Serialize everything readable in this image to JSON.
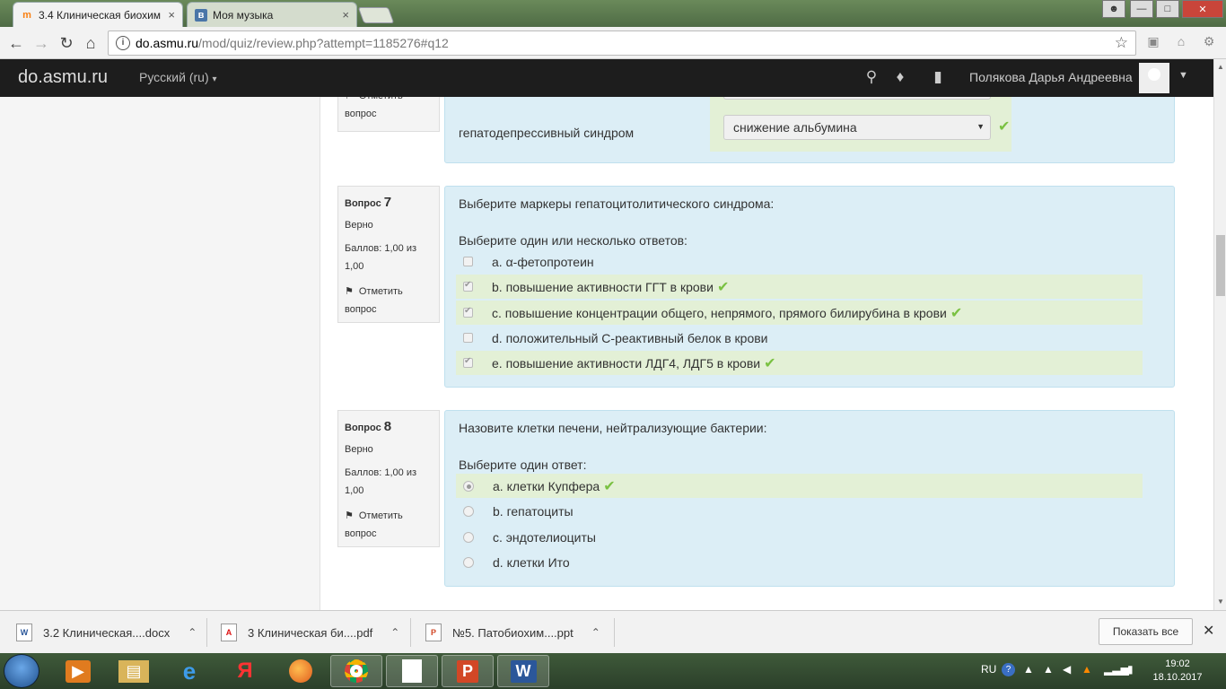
{
  "browser": {
    "tabs": [
      {
        "title": "3.4 Клиническая биохим",
        "favicon": "moodle-icon",
        "close": "×"
      },
      {
        "title": "Моя музыка",
        "favicon": "vk-icon",
        "close": "×"
      }
    ],
    "url_host": "do.asmu.ru",
    "url_path": "/mod/quiz/review.php?attempt=1185276#q12"
  },
  "navbar": {
    "brand": "do.asmu.ru",
    "language": "Русский (ru)",
    "user_name": "Полякова Дарья Андреевна"
  },
  "q6": {
    "flag_label": "Отметить",
    "flag_label2": "вопрос",
    "row_label": "гепатодепрессивный синдром",
    "select_value": "снижение альбумина"
  },
  "q7": {
    "number_prefix": "Вопрос",
    "number": "7",
    "state": "Верно",
    "grade": "Баллов: 1,00 из",
    "grade2": "1,00",
    "flag_label": "Отметить",
    "flag_label2": "вопрос",
    "question": "Выберите маркеры гепатоцитолитического синдрома:",
    "prompt": "Выберите один или несколько ответов:",
    "options": [
      {
        "text": "a. α-фетопротеин",
        "checked": false,
        "correct": false
      },
      {
        "text": "b. повышение активности ГГТ в крови",
        "checked": true,
        "correct": true
      },
      {
        "text": "c. повышение концентрации общего, непрямого, прямого билирубина в крови",
        "checked": true,
        "correct": true
      },
      {
        "text": "d. положительный С-реактивный белок в крови",
        "checked": false,
        "correct": false
      },
      {
        "text": "e. повышение активности ЛДГ4, ЛДГ5 в крови",
        "checked": true,
        "correct": true
      }
    ]
  },
  "q8": {
    "number_prefix": "Вопрос",
    "number": "8",
    "state": "Верно",
    "grade": "Баллов: 1,00 из",
    "grade2": "1,00",
    "flag_label": "Отметить",
    "flag_label2": "вопрос",
    "question": "Назовите клетки печени, нейтрализующие бактерии:",
    "prompt": "Выберите один ответ:",
    "options": [
      {
        "text": "a. клетки Купфера",
        "checked": true,
        "correct": true
      },
      {
        "text": "b. гепатоциты",
        "checked": false,
        "correct": false
      },
      {
        "text": "c. эндотелиоциты",
        "checked": false,
        "correct": false
      },
      {
        "text": "d. клетки Ито",
        "checked": false,
        "correct": false
      }
    ]
  },
  "downloads": {
    "items": [
      {
        "name": "3.2 Клиническая....docx",
        "icon": "word-doc-icon"
      },
      {
        "name": "3 Клиническая би....pdf",
        "icon": "pdf-icon"
      },
      {
        "name": "№5. Патобиохим....ppt",
        "icon": "powerpoint-icon"
      }
    ],
    "show_all": "Показать все"
  },
  "taskbar": {
    "language": "RU",
    "time": "19:02",
    "date": "18.10.2017"
  },
  "colors": {
    "question_bg": "#dceef6",
    "correct_bg": "#e3f0d6",
    "tick": "#7ac142",
    "navbar": "#1d1d1d"
  }
}
